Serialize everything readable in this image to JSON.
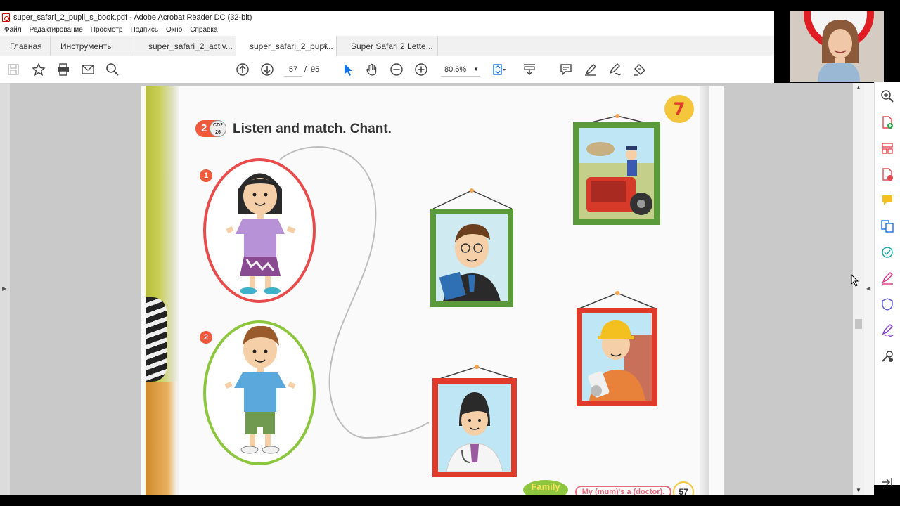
{
  "window": {
    "title": "super_safari_2_pupil_s_book.pdf - Adobe Acrobat Reader DC (32-bit)"
  },
  "menu": [
    "Файл",
    "Редактирование",
    "Просмотр",
    "Подпись",
    "Окно",
    "Справка"
  ],
  "tabs": [
    {
      "label": "Главная",
      "active": false
    },
    {
      "label": "Инструменты",
      "active": false
    },
    {
      "label": "super_safari_2_activ...",
      "active": false
    },
    {
      "label": "super_safari_2_pupi...",
      "active": true
    },
    {
      "label": "Super Safari 2 Lette...",
      "active": false
    }
  ],
  "tab_close_glyph": "×",
  "toolbar": {
    "page_current": "57",
    "page_sep": "/",
    "page_total": "95",
    "zoom": "80,6%",
    "icons": [
      "save-icon",
      "bookmark-star-icon",
      "print-icon",
      "email-icon",
      "search-zoom-icon",
      "page-up-icon",
      "page-down-icon",
      "select-arrow-icon",
      "hand-icon",
      "zoom-out-icon",
      "zoom-in-icon",
      "fit-page-icon",
      "scroll-mode-icon",
      "comment-icon",
      "highlight-pen-icon",
      "sign-icon",
      "stamp-icon"
    ]
  },
  "page": {
    "lesson_number": "7",
    "exercise_number": "2",
    "cd_label": "CD2",
    "cd_track": "26",
    "instruction": "Listen and match. Chant.",
    "items": [
      "1",
      "2"
    ],
    "footer_unit": "Family",
    "footer_sentence": "My (mum)'s a (doctor).",
    "page_number": "57"
  },
  "colors": {
    "accent_red": "#e23b2e",
    "acrobat_blue": "#1473e6",
    "frame_green": "#5a9a3a",
    "frame_red": "#e03a2a"
  },
  "right_tools": [
    "zoom-search-icon",
    "create-pdf-icon",
    "organize-pages-icon",
    "export-pdf-icon",
    "comment-tool-icon",
    "combine-files-icon",
    "send-review-icon",
    "fill-sign-icon",
    "protect-icon",
    "edit-pdf-icon",
    "more-tools-icon",
    "collapse-pane-icon"
  ]
}
